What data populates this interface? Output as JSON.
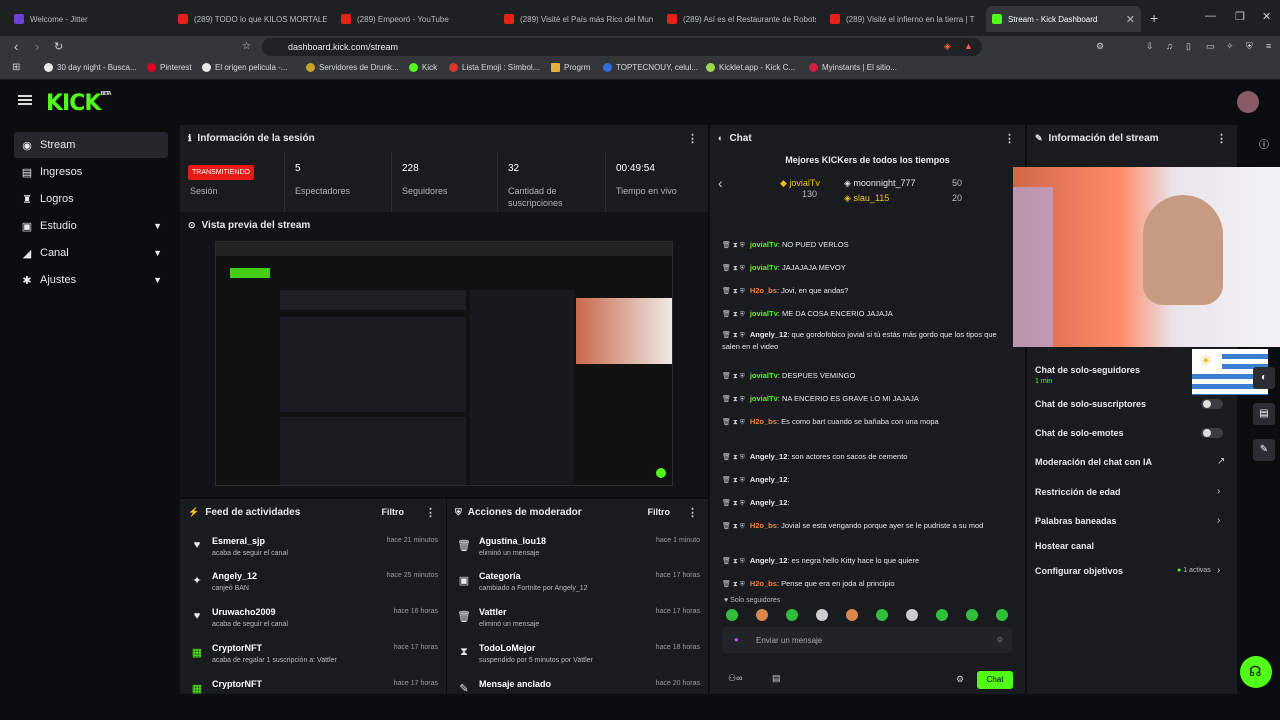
{
  "browser": {
    "tabs": [
      {
        "label": "Welcome - Jitter",
        "icon": "jitter-favicon"
      },
      {
        "label": "(289) TODO lo que KILOS MORTALES",
        "icon": "youtube-favicon"
      },
      {
        "label": "(289) Empeoró - YouTube",
        "icon": "youtube-favicon"
      },
      {
        "label": "(289) Visité el País más Rico del Mun",
        "icon": "youtube-favicon"
      },
      {
        "label": "(289) Así es el Restaurante de Robots",
        "icon": "youtube-favicon"
      },
      {
        "label": "(289) Visité el infierno en la tierra | T",
        "icon": "youtube-favicon"
      },
      {
        "label": "Stream - Kick Dashboard",
        "icon": "kick-favicon"
      }
    ],
    "url": "dashboard.kick.com/stream",
    "bookmarks": [
      "30 day night - Busca...",
      "Pinterest",
      "El origen pelicula -...",
      "Servidores de Drunk...",
      "Kick",
      "Lista Emoji : Símbol...",
      "Progrm",
      "TOPTECNOUY, celul...",
      "Kicklet.app - Kick C...",
      "Myinstants | El sitio..."
    ]
  },
  "brand": {
    "logo": "KICK",
    "beta": "BETA"
  },
  "sidebar": {
    "items": [
      {
        "label": "Stream",
        "icon": "stream-icon",
        "glyph": "◉"
      },
      {
        "label": "Ingresos",
        "icon": "income-icon",
        "glyph": "▤"
      },
      {
        "label": "Logros",
        "icon": "trophy-icon",
        "glyph": "♜"
      },
      {
        "label": "Estudio",
        "icon": "studio-icon",
        "glyph": "▣"
      },
      {
        "label": "Canal",
        "icon": "channel-icon",
        "glyph": "◢"
      },
      {
        "label": "Ajustes",
        "icon": "settings-icon",
        "glyph": "✱"
      }
    ]
  },
  "session": {
    "title": "Información de la sesión",
    "live": "TRANSMITIENDO",
    "live_label": "Sesión",
    "stats": [
      {
        "value": "5",
        "label": "Espectadores"
      },
      {
        "value": "228",
        "label": "Seguidores"
      },
      {
        "value": "32",
        "label": "Cantidad de suscripciones"
      },
      {
        "value": "00:49:54",
        "label": "Tiempo en vivo"
      }
    ]
  },
  "preview": {
    "title": "Vista previa del stream"
  },
  "activity": {
    "title": "Feed de actividades",
    "filter": "Filtro",
    "rows": [
      {
        "name": "Esmeral_sjp",
        "desc": "acaba de seguir el canal",
        "time": "hace 21 minutos",
        "icon": "heart-icon",
        "glyph": "♥"
      },
      {
        "name": "Angely_12",
        "desc": "canjeó BAN",
        "time": "hace 25 minutos",
        "icon": "users-icon",
        "glyph": "✦"
      },
      {
        "name": "Uruwacho2009",
        "desc": "acaba de seguir el canal",
        "time": "hace 16 horas",
        "icon": "heart-icon",
        "glyph": "♥"
      },
      {
        "name": "CryptorNFT",
        "desc": "acaba de regalar 1 suscripción a: Vattler",
        "time": "hace 17 horas",
        "icon": "gift-icon",
        "glyph": "▦"
      },
      {
        "name": "CryptorNFT",
        "desc": "",
        "time": "hace 17 horas",
        "icon": "gift-icon",
        "glyph": "▦"
      }
    ]
  },
  "modactions": {
    "title": "Acciones de moderador",
    "filter": "Filtro",
    "rows": [
      {
        "name": "Agustina_lou18",
        "desc": "eliminó un mensaje",
        "time": "hace 1 minuto",
        "icon": "trash-icon",
        "glyph": "🗑"
      },
      {
        "name": "Categoría",
        "desc": "cambiado a Fortnite por Angely_12",
        "time": "hace 17 horas",
        "icon": "category-icon",
        "glyph": "▣"
      },
      {
        "name": "Vattler",
        "desc": "eliminó un mensaje",
        "time": "hace 17 horas",
        "icon": "trash-icon",
        "glyph": "🗑"
      },
      {
        "name": "TodoLoMejor",
        "desc": "suspendido por 5 minutos por Vattler",
        "time": "hace 18 horas",
        "icon": "hourglass-icon",
        "glyph": "⧗"
      },
      {
        "name": "Mensaje anclado",
        "desc": "",
        "time": "hace 20 horas",
        "icon": "pin-icon",
        "glyph": "✎"
      }
    ]
  },
  "chat": {
    "title": "Chat",
    "leaders_title": "Mejores KICKers de todos los tiempos",
    "leaders": [
      {
        "name": "jovialTv",
        "score": "130"
      },
      {
        "name": "moonnight_777",
        "score": "50"
      },
      {
        "name": "slau_115",
        "score": "20"
      }
    ],
    "messages": [
      {
        "user": "jovialTv",
        "text": "NO PUED VERLOS",
        "color": "#53fc18"
      },
      {
        "user": "jovialTv",
        "text": "JAJAJAJA MEVOY",
        "color": "#53fc18"
      },
      {
        "user": "H2o_bs",
        "text": "Jovi, en que andas?",
        "color": "#ff7e36"
      },
      {
        "user": "jovialTv",
        "text": "ME DA COSA ENCERIO JAJAJA",
        "color": "#53fc18"
      },
      {
        "user": "Angely_12",
        "text": "que gordofobico jovial si tú estás más gordo que los tipos que salen en el video",
        "color": "#e7e9ea"
      },
      {
        "user": "jovialTv",
        "text": "DESPUES VEMINGO",
        "color": "#53fc18"
      },
      {
        "user": "jovialTv",
        "text": "NA ENCERIO ES GRAVE LO MI JAJAJA",
        "color": "#53fc18"
      },
      {
        "user": "H2o_bs",
        "text": "Es como bart cuando se bañaba con una mopa",
        "color": "#ff7e36"
      },
      {
        "user": "Angely_12",
        "text": "son actores con sacos de cemento",
        "color": "#e7e9ea"
      },
      {
        "user": "Angely_12",
        "text": "",
        "color": "#e7e9ea"
      },
      {
        "user": "Angely_12",
        "text": "",
        "color": "#e7e9ea"
      },
      {
        "user": "H2o_bs",
        "text": "Jovial se esta vengando porque ayer se le pudriste a su mod",
        "color": "#ff7e36"
      },
      {
        "user": "Angely_12",
        "text": "es negra hello Kitty hace lo que quiere",
        "color": "#e7e9ea"
      },
      {
        "user": "H2o_bs",
        "text": "Pense que era en joda al principio",
        "color": "#ff7e36"
      }
    ],
    "followers_only_label": "Solo seguidores",
    "input_placeholder": "Enviar un mensaje",
    "send": "Chat"
  },
  "info": {
    "title": "Información del stream",
    "rows": [
      {
        "label": "Chat de solo-seguidores",
        "sub": "1 min",
        "control": "none"
      },
      {
        "label": "Chat de solo-suscriptores",
        "control": "toggle"
      },
      {
        "label": "Chat de solo-emotes",
        "control": "toggle"
      },
      {
        "label": "Moderación del chat con IA",
        "control": "external"
      },
      {
        "label": "Restricción de edad",
        "control": "arrow"
      },
      {
        "label": "Palabras baneadas",
        "control": "arrow"
      },
      {
        "label": "Hostear canal",
        "control": "none"
      },
      {
        "label": "Configurar objetivos",
        "control": "arrow",
        "badge": "1 activas"
      }
    ]
  },
  "colors": {
    "accent": "#53fc18",
    "live": "#e91916",
    "panel": "#191b1f",
    "bg": "#0b0e0f"
  }
}
